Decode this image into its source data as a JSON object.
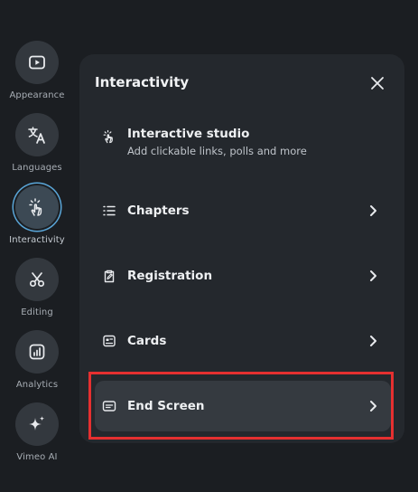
{
  "rail": {
    "items": [
      {
        "label": "Appearance",
        "icon": "play-icon"
      },
      {
        "label": "Languages",
        "icon": "translate-icon"
      },
      {
        "label": "Interactivity",
        "icon": "tap-icon"
      },
      {
        "label": "Editing",
        "icon": "scissors-icon"
      },
      {
        "label": "Analytics",
        "icon": "bar-chart-icon"
      },
      {
        "label": "Vimeo AI",
        "icon": "sparkle-icon"
      }
    ],
    "active": "Interactivity"
  },
  "panel": {
    "title": "Interactivity",
    "studio": {
      "label": "Interactive studio",
      "subtitle": "Add clickable links, polls and more",
      "icon": "tap-icon"
    },
    "rows": [
      {
        "label": "Chapters",
        "icon": "list-icon"
      },
      {
        "label": "Registration",
        "icon": "clipboard-icon"
      },
      {
        "label": "Cards",
        "icon": "card-icon"
      },
      {
        "label": "End Screen",
        "icon": "end-screen-icon"
      }
    ],
    "highlighted_row": "End Screen"
  },
  "colors": {
    "background": "#1b1e22",
    "panel": "#24282d",
    "highlight": "#353a40",
    "focus_outline": "#e53030",
    "active_ring": "#5aa6d8"
  }
}
